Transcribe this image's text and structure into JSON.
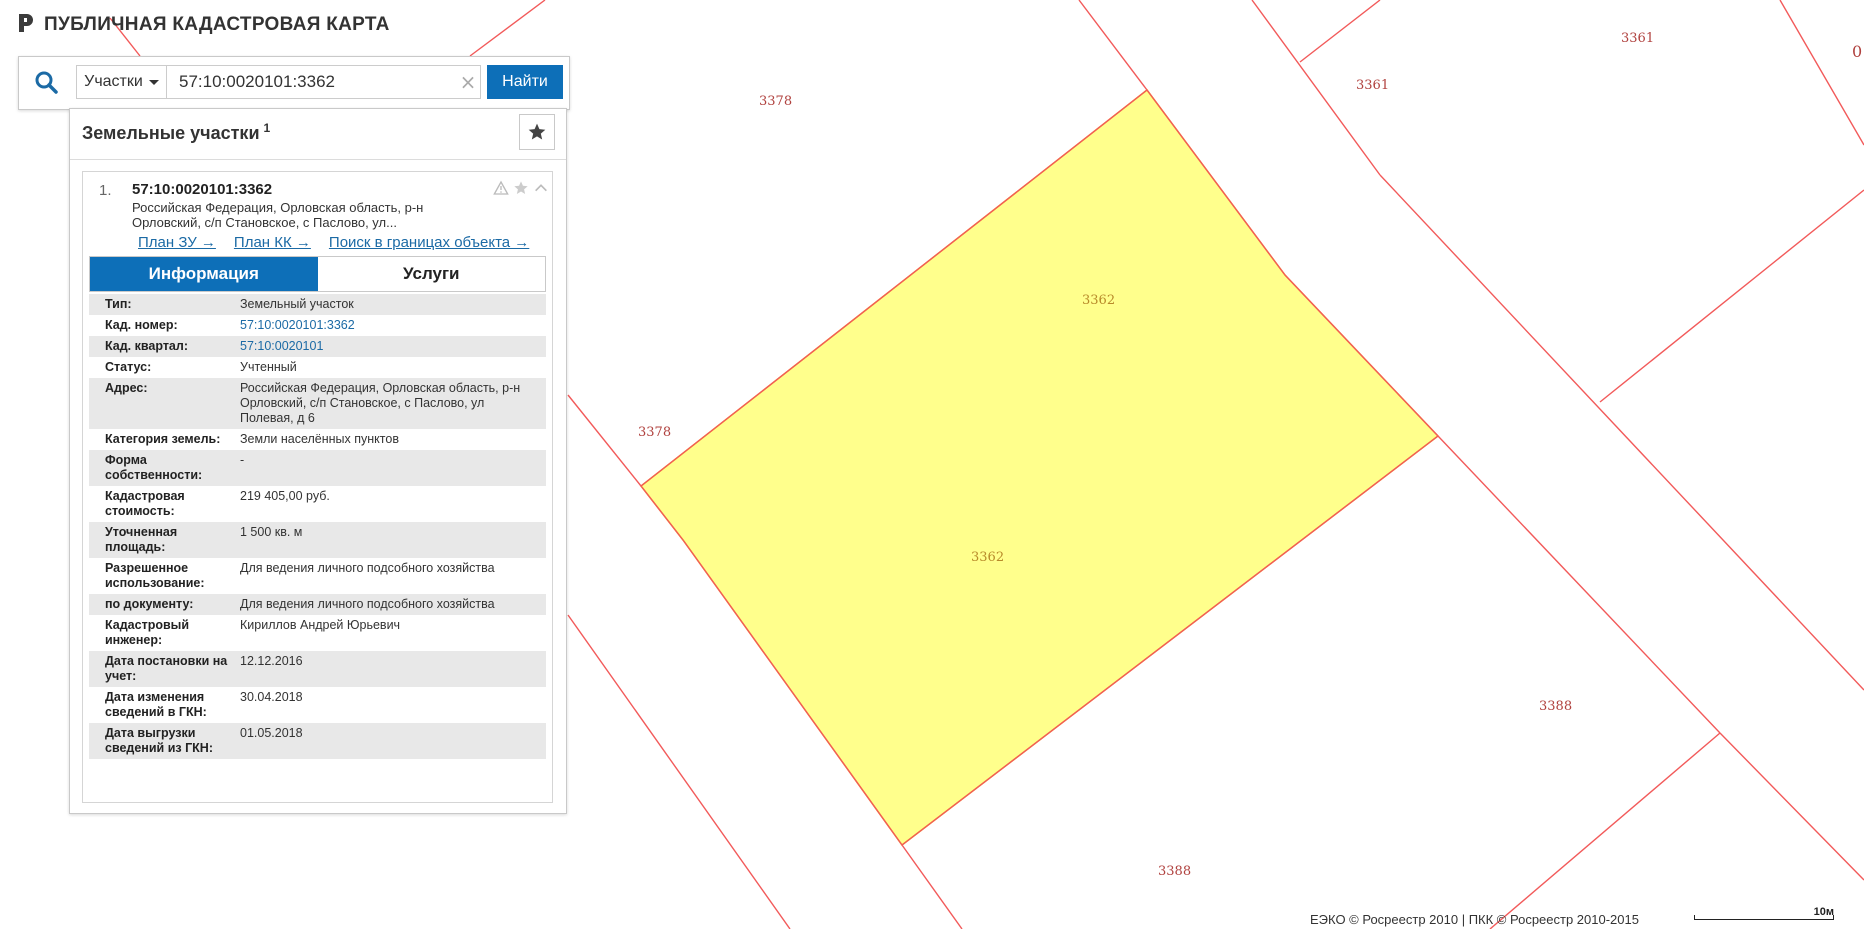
{
  "app": {
    "title": "ПУБЛИЧНАЯ КАДАСТРОВАЯ КАРТА"
  },
  "search": {
    "type_label": "Участки",
    "query": "57:10:0020101:3362",
    "button_label": "Найти"
  },
  "panel": {
    "title": "Земельные участки",
    "count": "1"
  },
  "result": {
    "number": "1.",
    "cad_number": "57:10:0020101:3362",
    "address_short": "Российская Федерация, Орловская область, р-н Орловский, с/п Становское, с Паслово, ул...",
    "links": {
      "plan_zu": "План ЗУ →",
      "plan_kk": "План КК →",
      "search_in_bounds": "Поиск в границах объекта →"
    },
    "tabs": {
      "info": "Информация",
      "services": "Услуги"
    },
    "fields": {
      "type": {
        "label": "Тип:",
        "value": "Земельный участок"
      },
      "cad_num": {
        "label": "Кад. номер:",
        "value": "57:10:0020101:3362"
      },
      "cad_quarter": {
        "label": "Кад. квартал:",
        "value": "57:10:0020101"
      },
      "status": {
        "label": "Статус:",
        "value": "Учтенный"
      },
      "address": {
        "label": "Адрес:",
        "value": "Российская Федерация, Орловская область, р-н Орловский, с/п Становское, с Паслово, ул Полевая, д 6"
      },
      "land_category": {
        "label": "Категория земель:",
        "value": "Земли населённых пунктов"
      },
      "ownership": {
        "label": "Форма собственности:",
        "value": "-"
      },
      "cad_value": {
        "label": "Кадастровая стоимость:",
        "value": "219 405,00 руб."
      },
      "area": {
        "label": "Уточненная площадь:",
        "value": "1 500 кв. м"
      },
      "permitted_use": {
        "label": "Разрешенное использование:",
        "value": "Для ведения личного подсобного хозяйства"
      },
      "by_document": {
        "label": "по документу:",
        "value": "Для ведения личного подсобного хозяйства"
      },
      "engineer": {
        "label": "Кадастровый инженер:",
        "value": "Кириллов Андрей Юрьевич"
      },
      "registered": {
        "label": "Дата постановки на учет:",
        "value": "12.12.2016"
      },
      "changed": {
        "label": "Дата изменения сведений в ГКН:",
        "value": "30.04.2018"
      },
      "exported": {
        "label": "Дата выгрузки сведений из ГКН:",
        "value": "01.05.2018"
      }
    }
  },
  "map": {
    "labels": {
      "l3378a": "3378",
      "l3378b": "3378",
      "l3361a": "3361",
      "l3361b": "3361",
      "l3362a": "3362",
      "l3362b": "3362",
      "l3388a": "3388",
      "l3388b": "3388",
      "l0": "0"
    },
    "parcel_fill": "#ffff8c",
    "boundary_color": "#f25a5a"
  },
  "footer": {
    "attribution": "ЕЭКО © Росреестр 2010 | ПКК © Росреестр 2010-2015",
    "scale": "10м"
  },
  "colors": {
    "accent": "#0d6fb8",
    "link": "#1b6aa5"
  }
}
